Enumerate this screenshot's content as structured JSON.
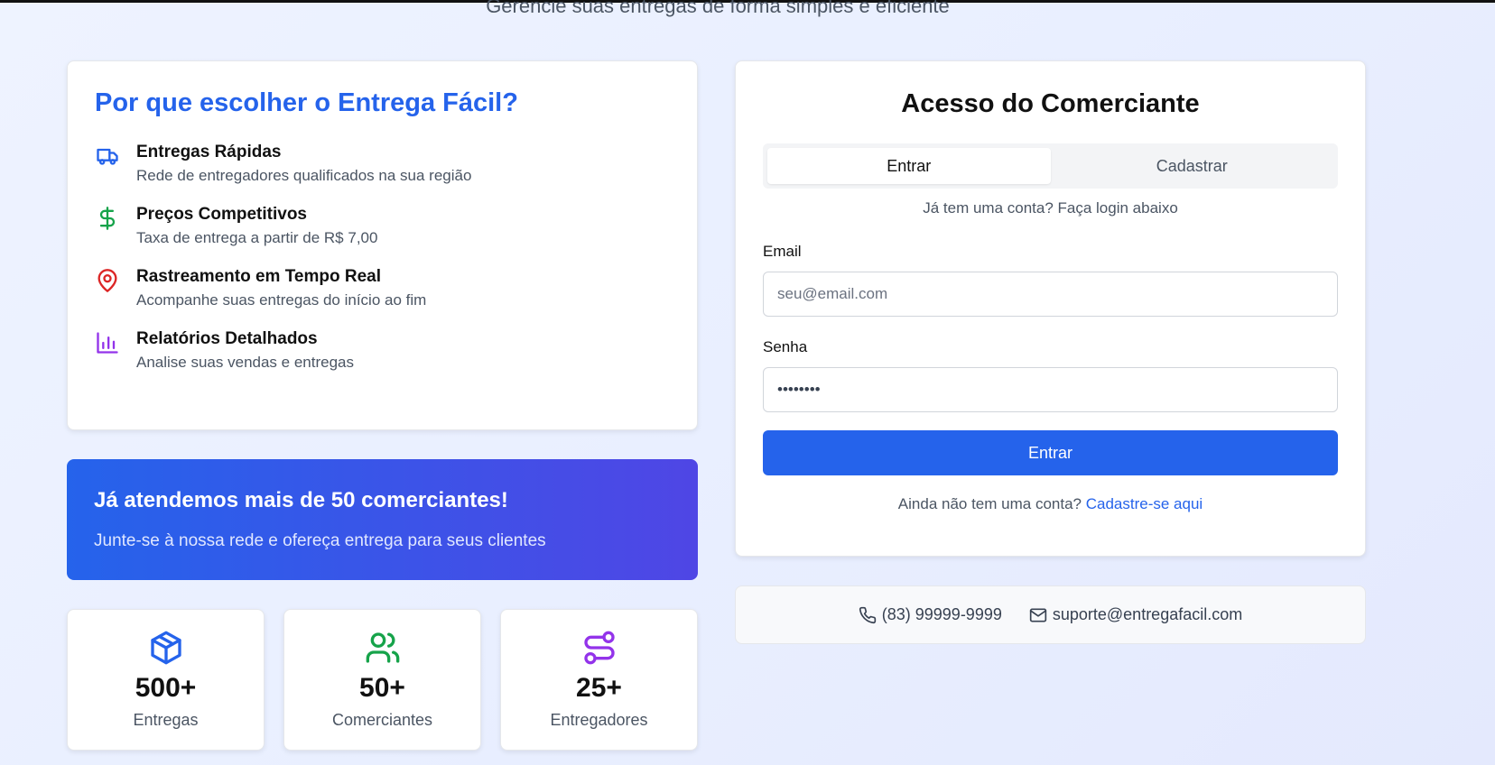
{
  "header": {
    "subtitle": "Gerencie suas entregas de forma simples e eficiente"
  },
  "features": {
    "title": "Por que escolher o Entrega Fácil?",
    "items": [
      {
        "icon": "truck-icon",
        "color": "#2563eb",
        "title": "Entregas Rápidas",
        "desc": "Rede de entregadores qualificados na sua região"
      },
      {
        "icon": "dollar-icon",
        "color": "#16a34a",
        "title": "Preços Competitivos",
        "desc": "Taxa de entrega a partir de R$ 7,00"
      },
      {
        "icon": "map-pin-icon",
        "color": "#dc2626",
        "title": "Rastreamento em Tempo Real",
        "desc": "Acompanhe suas entregas do início ao fim"
      },
      {
        "icon": "bar-chart-icon",
        "color": "#9333ea",
        "title": "Relatórios Detalhados",
        "desc": "Analise suas vendas e entregas"
      }
    ]
  },
  "banner": {
    "title": "Já atendemos mais de 50 comerciantes!",
    "desc": "Junte-se à nossa rede e ofereça entrega para seus clientes"
  },
  "stats": [
    {
      "icon": "package-icon",
      "color": "#2563eb",
      "value": "500+",
      "label": "Entregas"
    },
    {
      "icon": "users-icon",
      "color": "#16a34a",
      "value": "50+",
      "label": "Comerciantes"
    },
    {
      "icon": "route-icon",
      "color": "#9333ea",
      "value": "25+",
      "label": "Entregadores"
    }
  ],
  "login": {
    "title": "Acesso do Comerciante",
    "tabs": [
      "Entrar",
      "Cadastrar"
    ],
    "active_tab": "Entrar",
    "hint": "Já tem uma conta? Faça login abaixo",
    "email_label": "Email",
    "email_placeholder": "seu@email.com",
    "password_label": "Senha",
    "password_value": "••••••••",
    "submit_label": "Entrar",
    "footer_text": "Ainda não tem uma conta?",
    "footer_link": "Cadastre-se aqui"
  },
  "contact": {
    "phone": "(83) 99999-9999",
    "email": "suporte@entregafacil.com"
  },
  "colors": {
    "primary": "#2563eb",
    "banner_end": "#4f46e5"
  }
}
